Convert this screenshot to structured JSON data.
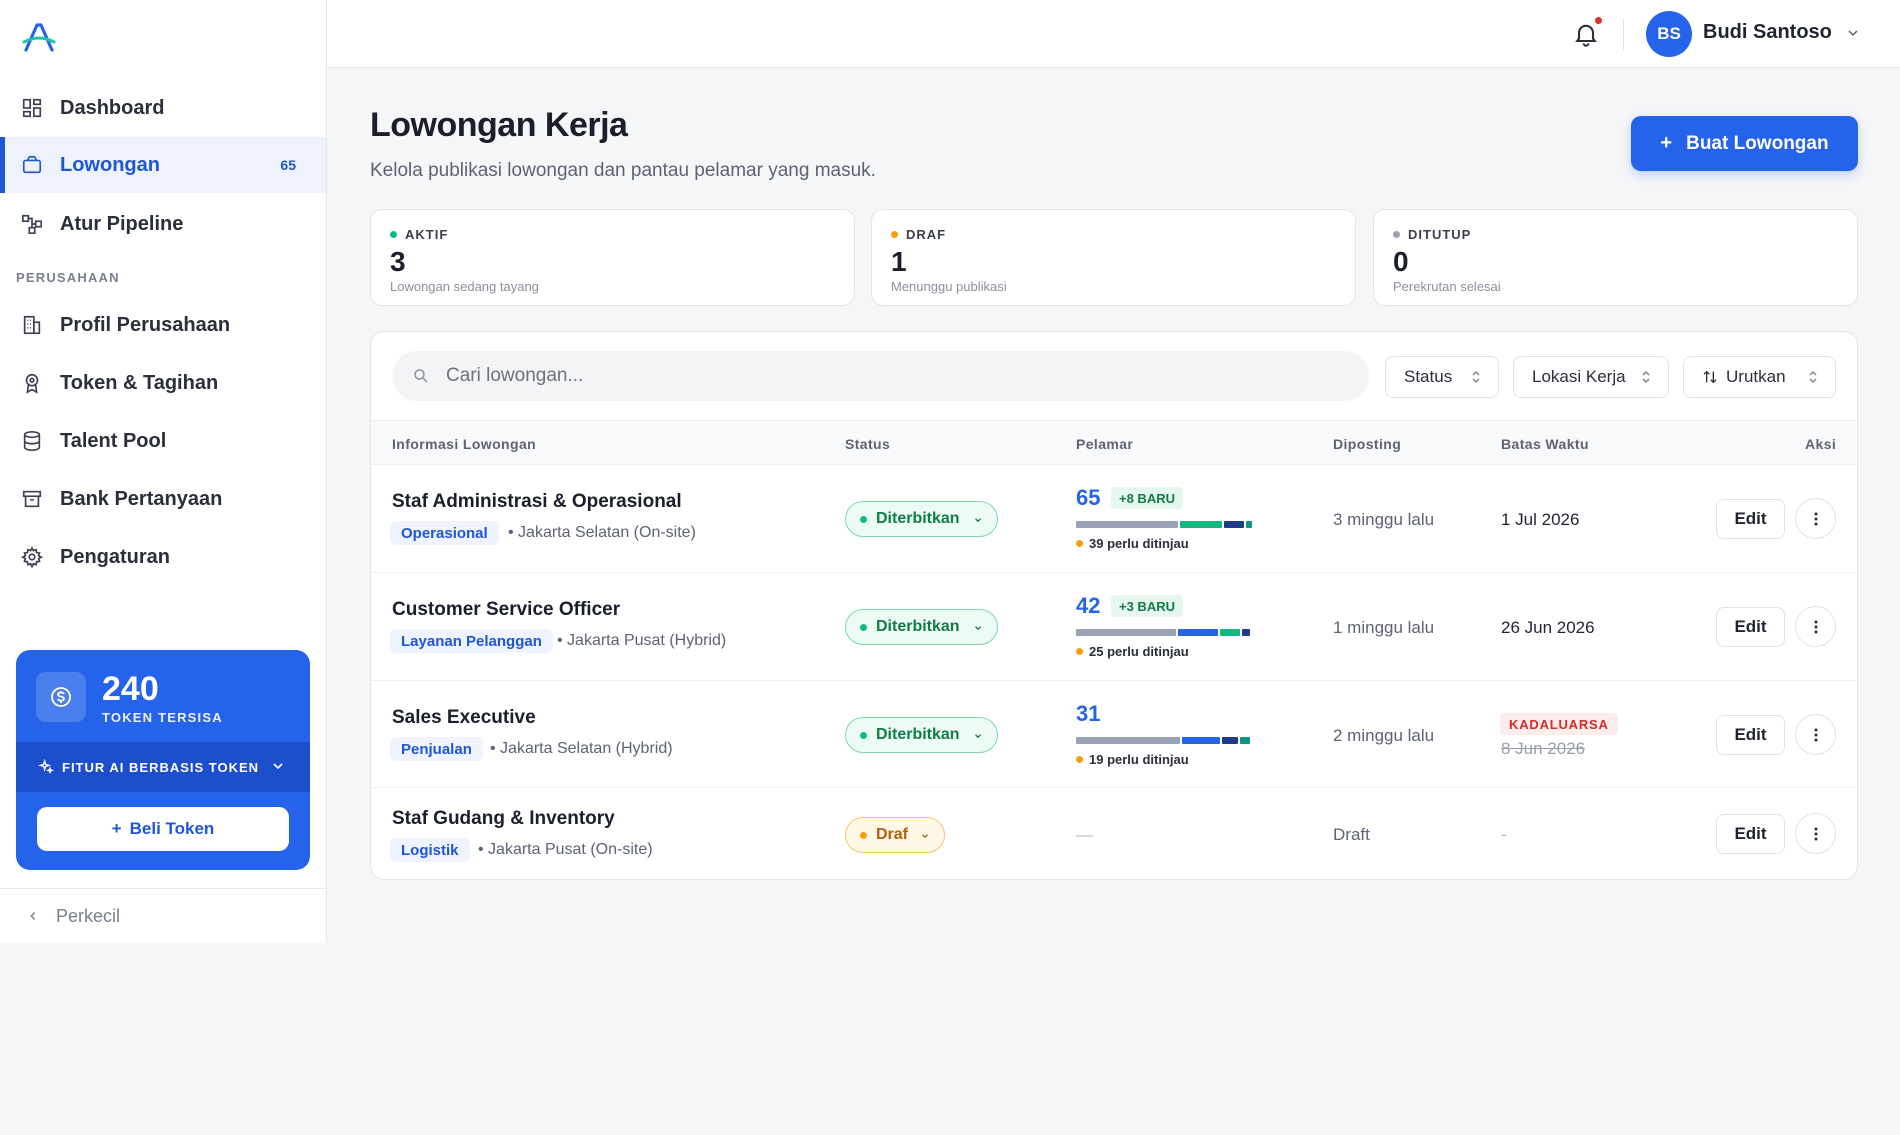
{
  "app": {
    "logo": "logo-icon"
  },
  "sidebar": {
    "items": [
      {
        "label": "Dashboard",
        "icon": "dashboard-icon"
      },
      {
        "label": "Lowongan",
        "icon": "briefcase-icon",
        "badge": "65",
        "active": true
      },
      {
        "label": "Atur Pipeline",
        "icon": "pipeline-icon"
      }
    ],
    "section_label": "PERUSAHAAN",
    "company_items": [
      {
        "label": "Profil Perusahaan",
        "icon": "building-icon"
      },
      {
        "label": "Token & Tagihan",
        "icon": "award-icon"
      },
      {
        "label": "Talent Pool",
        "icon": "database-icon"
      },
      {
        "label": "Bank Pertanyaan",
        "icon": "archive-icon"
      },
      {
        "label": "Pengaturan",
        "icon": "gear-icon"
      }
    ],
    "token": {
      "count": "240",
      "label": "TOKEN TERSISA",
      "feature": "FITUR AI BERBASIS TOKEN",
      "buy_label": "Beli Token"
    },
    "collapse_label": "Perkecil"
  },
  "topbar": {
    "avatar_initials": "BS",
    "user_name": "Budi Santoso"
  },
  "header": {
    "title": "Lowongan Kerja",
    "subtitle": "Kelola publikasi lowongan dan pantau pelamar yang masuk.",
    "create_label": "Buat Lowongan"
  },
  "stats": [
    {
      "label": "AKTIF",
      "value": "3",
      "desc": "Lowongan sedang tayang",
      "color": "#10b981"
    },
    {
      "label": "DRAF",
      "value": "1",
      "desc": "Menunggu publikasi",
      "color": "#f59e0b"
    },
    {
      "label": "DITUTUP",
      "value": "0",
      "desc": "Perekrutan selesai",
      "color": "#9ca3af"
    }
  ],
  "toolbar": {
    "search_placeholder": "Cari lowongan...",
    "filter_status": "Status",
    "filter_location": "Lokasi Kerja",
    "sort_label": "Urutkan"
  },
  "table": {
    "headers": [
      "Informasi Lowongan",
      "Status",
      "Pelamar",
      "Diposting",
      "Batas Waktu",
      "Aksi"
    ],
    "rows": [
      {
        "title": "Staf Administrasi & Operasional",
        "category": "Operasional",
        "location": "• Jakarta Selatan (On-site)",
        "status": "Diterbitkan",
        "applicants": "65",
        "new_badge": "+8 BARU",
        "review": "39 perlu ditinjau",
        "posted": "3 minggu lalu",
        "deadline": "1 Jul 2026",
        "edit": "Edit"
      },
      {
        "title": "Customer Service Officer",
        "category": "Layanan Pelanggan",
        "location": "• Jakarta Pusat (Hybrid)",
        "status": "Diterbitkan",
        "applicants": "42",
        "new_badge": "+3 BARU",
        "review": "25 perlu ditinjau",
        "posted": "1 minggu lalu",
        "deadline": "26 Jun 2026",
        "edit": "Edit"
      },
      {
        "title": "Sales Executive",
        "category": "Penjualan",
        "location": "• Jakarta Selatan (Hybrid)",
        "status": "Diterbitkan",
        "applicants": "31",
        "review": "19 perlu ditinjau",
        "posted": "2 minggu lalu",
        "expired_label": "KADALUARSA",
        "deadline": "8 Jun 2026",
        "edit": "Edit"
      },
      {
        "title": "Staf Gudang & Inventory",
        "category": "Logistik",
        "location": "• Jakarta Pusat (On-site)",
        "status": "Draf",
        "applicants_empty": "—",
        "posted": "Draft",
        "deadline_empty": "-",
        "edit": "Edit"
      }
    ]
  }
}
